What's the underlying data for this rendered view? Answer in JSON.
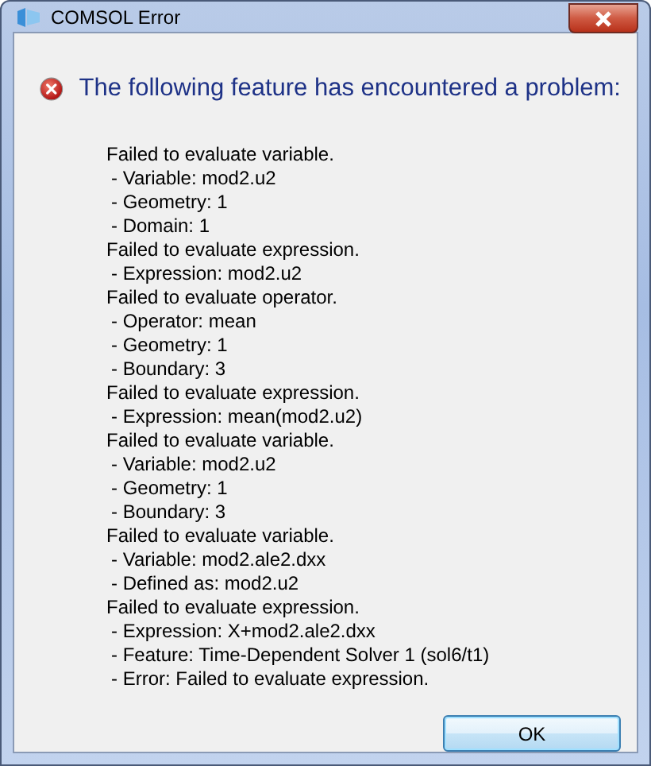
{
  "window": {
    "title": "COMSOL Error"
  },
  "heading": "The following feature has encountered a problem:",
  "messages": [
    {
      "kind": "header",
      "text": "Failed to evaluate variable."
    },
    {
      "kind": "detail",
      "text": "- Variable: mod2.u2"
    },
    {
      "kind": "detail",
      "text": "- Geometry: 1"
    },
    {
      "kind": "detail",
      "text": "- Domain: 1"
    },
    {
      "kind": "header",
      "text": "Failed to evaluate expression."
    },
    {
      "kind": "detail",
      "text": "- Expression: mod2.u2"
    },
    {
      "kind": "header",
      "text": "Failed to evaluate operator."
    },
    {
      "kind": "detail",
      "text": "- Operator: mean"
    },
    {
      "kind": "detail",
      "text": "- Geometry: 1"
    },
    {
      "kind": "detail",
      "text": "- Boundary: 3"
    },
    {
      "kind": "header",
      "text": "Failed to evaluate expression."
    },
    {
      "kind": "detail",
      "text": "- Expression: mean(mod2.u2)"
    },
    {
      "kind": "header",
      "text": "Failed to evaluate variable."
    },
    {
      "kind": "detail",
      "text": "- Variable: mod2.u2"
    },
    {
      "kind": "detail",
      "text": "- Geometry: 1"
    },
    {
      "kind": "detail",
      "text": "- Boundary: 3"
    },
    {
      "kind": "header",
      "text": "Failed to evaluate variable."
    },
    {
      "kind": "detail",
      "text": "- Variable: mod2.ale2.dxx"
    },
    {
      "kind": "detail",
      "text": "- Defined as: mod2.u2"
    },
    {
      "kind": "header",
      "text": "Failed to evaluate expression."
    },
    {
      "kind": "detail",
      "text": "- Expression: X+mod2.ale2.dxx"
    },
    {
      "kind": "detail",
      "text": "- Feature: Time-Dependent Solver 1 (sol6/t1)"
    },
    {
      "kind": "detail",
      "text": "- Error: Failed to evaluate expression."
    }
  ],
  "buttons": [
    "OK"
  ]
}
